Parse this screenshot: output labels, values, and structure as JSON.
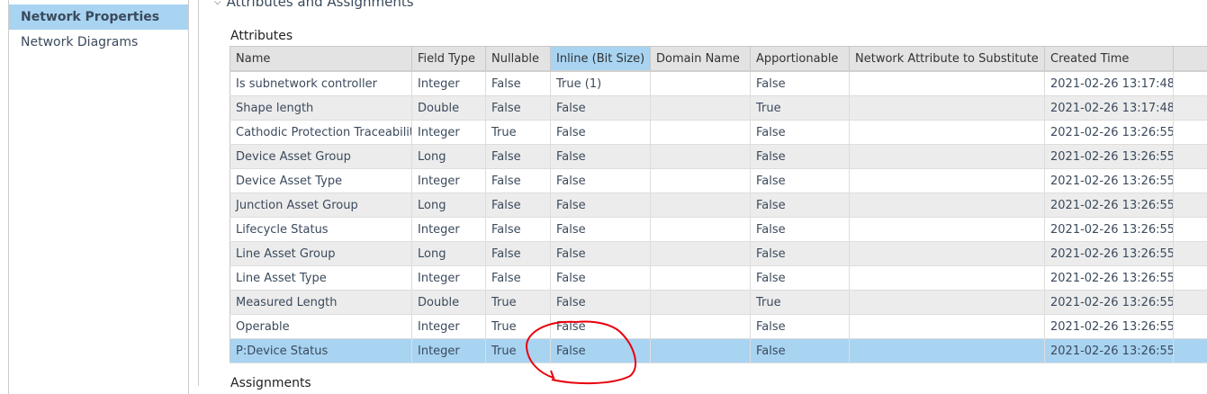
{
  "sidebar": {
    "items": [
      {
        "label": "Network Properties",
        "active": true
      },
      {
        "label": "Network Diagrams",
        "active": false
      }
    ]
  },
  "section": {
    "title": "Attributes and Assignments",
    "attributes_label": "Attributes",
    "assignments_label": "Assignments"
  },
  "table": {
    "columns": [
      "Name",
      "Field Type",
      "Nullable",
      "Inline (Bit Size)",
      "Domain Name",
      "Apportionable",
      "Network Attribute to Substitute",
      "Created Time",
      ""
    ],
    "highlighted_column": 3,
    "rows": [
      [
        "Is subnetwork controller",
        "Integer",
        "False",
        "True (1)",
        "",
        "False",
        "",
        "2021-02-26 13:17:48"
      ],
      [
        "Shape length",
        "Double",
        "False",
        "False",
        "",
        "True",
        "",
        "2021-02-26 13:17:48"
      ],
      [
        "Cathodic Protection Traceability",
        "Integer",
        "True",
        "False",
        "",
        "False",
        "",
        "2021-02-26 13:26:55"
      ],
      [
        "Device Asset Group",
        "Long",
        "False",
        "False",
        "",
        "False",
        "",
        "2021-02-26 13:26:55"
      ],
      [
        "Device Asset Type",
        "Integer",
        "False",
        "False",
        "",
        "False",
        "",
        "2021-02-26 13:26:55"
      ],
      [
        "Junction Asset Group",
        "Long",
        "False",
        "False",
        "",
        "False",
        "",
        "2021-02-26 13:26:55"
      ],
      [
        "Lifecycle Status",
        "Integer",
        "False",
        "False",
        "",
        "False",
        "",
        "2021-02-26 13:26:55"
      ],
      [
        "Line Asset Group",
        "Long",
        "False",
        "False",
        "",
        "False",
        "",
        "2021-02-26 13:26:55"
      ],
      [
        "Line Asset Type",
        "Integer",
        "False",
        "False",
        "",
        "False",
        "",
        "2021-02-26 13:26:55"
      ],
      [
        "Measured Length",
        "Double",
        "True",
        "False",
        "",
        "True",
        "",
        "2021-02-26 13:26:55"
      ],
      [
        "Operable",
        "Integer",
        "True",
        "False",
        "",
        "False",
        "",
        "2021-02-26 13:26:55"
      ],
      [
        "P:Device Status",
        "Integer",
        "True",
        "False",
        "",
        "False",
        "",
        "2021-02-26 13:26:55"
      ]
    ],
    "selected_row": 11
  },
  "colors": {
    "selection": "#a8d4f2",
    "annotation": "#e8000b"
  }
}
